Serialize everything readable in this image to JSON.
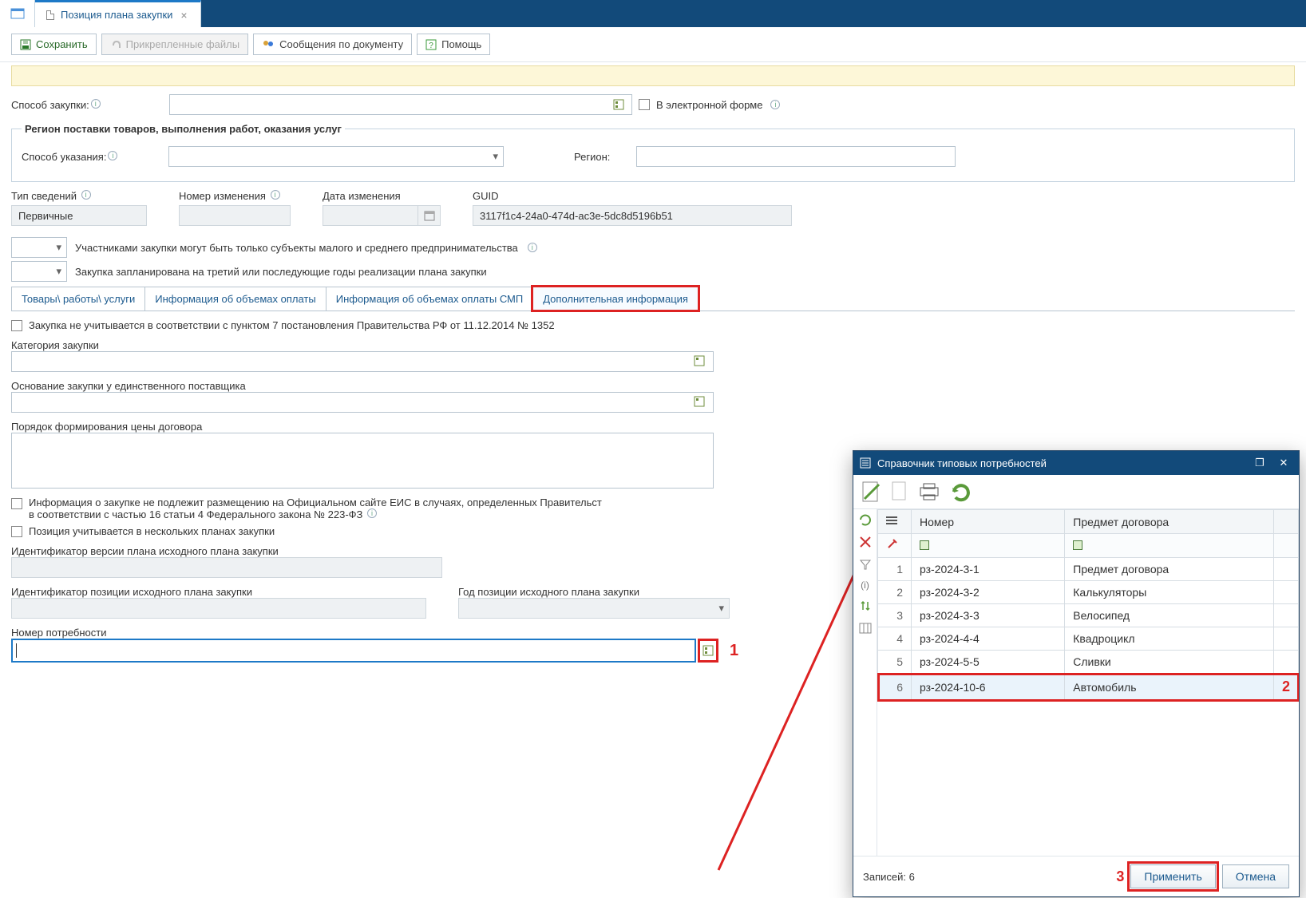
{
  "tabs": {
    "main_tab": "Позиция плана закупки"
  },
  "toolbar": {
    "save": "Сохранить",
    "attachments": "Прикрепленные файлы",
    "messages": "Сообщения по документу",
    "help": "Помощь"
  },
  "fields": {
    "purchase_method_label": "Способ закупки:",
    "electronic_form": "В электронной форме",
    "region_legend": "Регион поставки товаров, выполнения работ, оказания услуг",
    "spec_method_label": "Способ указания:",
    "region_label": "Регион:",
    "info_type_label": "Тип сведений",
    "info_type_value": "Первичные",
    "change_no_label": "Номер изменения",
    "change_date_label": "Дата изменения",
    "guid_label": "GUID",
    "guid_value": "3117f1c4-24a0-474d-ac3e-5dc8d5196b51",
    "smb_text": "Участниками закупки могут быть только субъекты малого и среднего предпринимательства",
    "planned_text": "Закупка запланирована на третий или последующие годы реализации плана закупки",
    "subtabs": {
      "t1": "Товары\\ работы\\ услуги",
      "t2": "Информация об объемах оплаты",
      "t3": "Информация об объемах оплаты СМП",
      "t4": "Дополнительная информация"
    },
    "chk_1352": "Закупка не учитывается в соответствии с пунктом 7 постановления Правительства РФ от 11.12.2014 № 1352",
    "cat_label": "Категория закупки",
    "basis_label": "Основание закупки у единственного поставщика",
    "price_order_label": "Порядок формирования цены договора",
    "eis_text1": "Информация о закупке не подлежит размещению на Официальном сайте ЕИС в случаях, определенных Правительст",
    "eis_text2": "в соответствии с частью 16 статьи 4 Федерального закона № 223-ФЗ",
    "multi_plans": "Позиция учитывается в нескольких планах закупки",
    "ver_id_label": "Идентификатор версии плана исходного плана закупки",
    "pos_id_label": "Идентификатор позиции исходного плана закупки",
    "year_pos_label": "Год позиции исходного плана закупки",
    "need_no_label": "Номер потребности"
  },
  "callouts": {
    "c1": "1",
    "c2": "2",
    "c3": "3"
  },
  "dialog": {
    "title": "Справочник типовых потребностей",
    "col_num": "Номер",
    "col_subject": "Предмет договора",
    "rows": [
      {
        "n": "1",
        "num": "рз-2024-3-1",
        "subj": "Предмет договора"
      },
      {
        "n": "2",
        "num": "рз-2024-3-2",
        "subj": "Калькуляторы"
      },
      {
        "n": "3",
        "num": "рз-2024-3-3",
        "subj": "Велосипед"
      },
      {
        "n": "4",
        "num": "рз-2024-4-4",
        "subj": "Квадроцикл"
      },
      {
        "n": "5",
        "num": "рз-2024-5-5",
        "subj": "Сливки"
      },
      {
        "n": "6",
        "num": "рз-2024-10-6",
        "subj": "Автомобиль"
      }
    ],
    "footer_count": "Записей: 6",
    "apply": "Применить",
    "cancel": "Отмена"
  }
}
